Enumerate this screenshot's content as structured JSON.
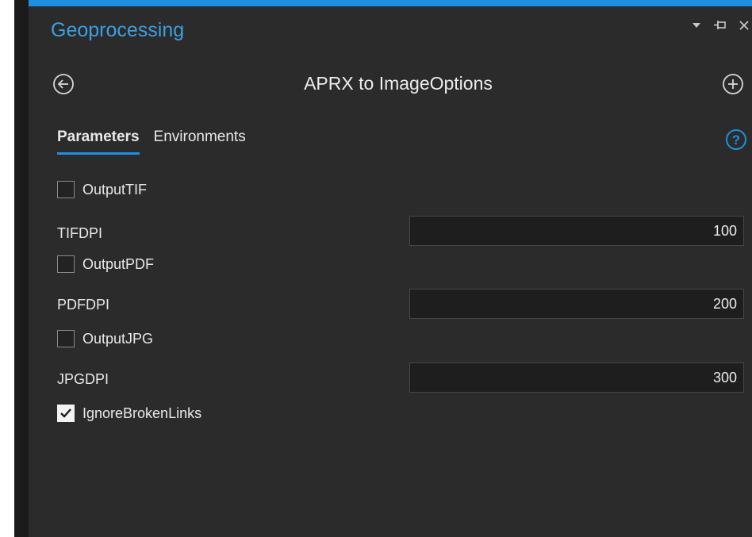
{
  "pane": {
    "title": "Geoprocessing",
    "controls": [
      "dropdown-arrow",
      "pin",
      "close"
    ]
  },
  "tool": {
    "name": "APRX to ImageOptions",
    "back_icon": "back-arrow-circle",
    "add_icon": "plus-circle"
  },
  "tabs": [
    {
      "label": "Parameters",
      "active": true
    },
    {
      "label": "Environments",
      "active": false
    }
  ],
  "help_icon": "question-circle",
  "params": {
    "output_tif": {
      "label": "OutputTIF",
      "checked": false
    },
    "tif_dpi": {
      "label": "TIFDPI",
      "value": "100"
    },
    "output_pdf": {
      "label": "OutputPDF",
      "checked": false
    },
    "pdf_dpi": {
      "label": "PDFDPI",
      "value": "200"
    },
    "output_jpg": {
      "label": "OutputJPG",
      "checked": false
    },
    "jpg_dpi": {
      "label": "JPGDPI",
      "value": "300"
    },
    "ignore_broken_links": {
      "label": "IgnoreBrokenLinks",
      "checked": true
    }
  },
  "colors": {
    "accent": "#1e8fe1",
    "title": "#3d9fe0",
    "background": "#2b2b2b",
    "input_bg": "#1e1e1e"
  }
}
